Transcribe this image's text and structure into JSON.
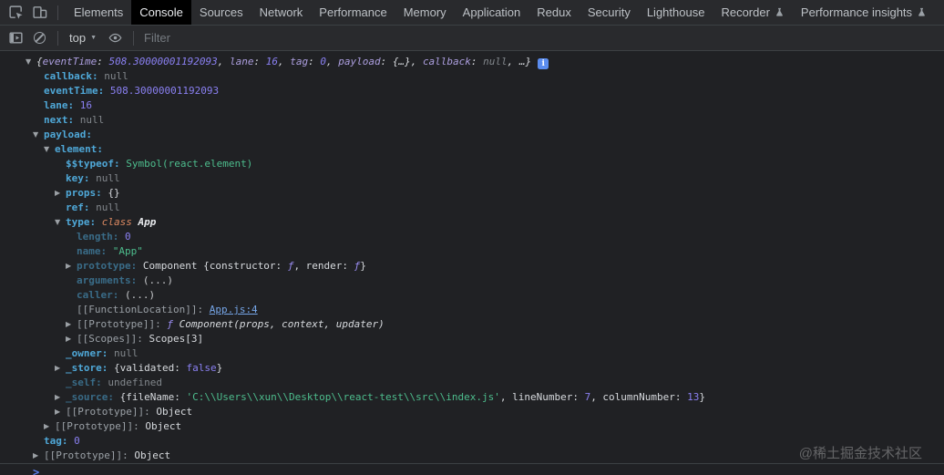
{
  "devtools": {
    "tabs": [
      {
        "label": "Elements",
        "active": false,
        "flask": false
      },
      {
        "label": "Console",
        "active": true,
        "flask": false
      },
      {
        "label": "Sources",
        "active": false,
        "flask": false
      },
      {
        "label": "Network",
        "active": false,
        "flask": false
      },
      {
        "label": "Performance",
        "active": false,
        "flask": false
      },
      {
        "label": "Memory",
        "active": false,
        "flask": false
      },
      {
        "label": "Application",
        "active": false,
        "flask": false
      },
      {
        "label": "Redux",
        "active": false,
        "flask": false
      },
      {
        "label": "Security",
        "active": false,
        "flask": false
      },
      {
        "label": "Lighthouse",
        "active": false,
        "flask": false
      },
      {
        "label": "Recorder",
        "active": false,
        "flask": true
      },
      {
        "label": "Performance insights",
        "active": false,
        "flask": true
      }
    ]
  },
  "toolbar": {
    "context": "top",
    "filter_placeholder": "Filter"
  },
  "colors": {
    "background": "#202124",
    "toolbar": "#292a2d",
    "active_tab": "#000000",
    "property_key": "#4fa8d8",
    "number": "#8a80f2",
    "string": "#4dbd8d",
    "null_undefined": "#82878c",
    "preview_key": "#ad9fe0",
    "keyword": "#de8a62",
    "link": "#76a6e8",
    "info_badge": "#5b8def"
  },
  "console": {
    "rows": [
      {
        "indent": 0,
        "arrow": "v",
        "key": "",
        "kc": "",
        "italic": true,
        "info": true,
        "segs": [
          [
            "{",
            "obj"
          ],
          [
            "eventTime",
            "pkey"
          ],
          [
            ": ",
            "obj"
          ],
          [
            "508.30000001192093",
            "num"
          ],
          [
            ", ",
            "obj"
          ],
          [
            "lane",
            "pkey"
          ],
          [
            ": ",
            "obj"
          ],
          [
            "16",
            "num"
          ],
          [
            ", ",
            "obj"
          ],
          [
            "tag",
            "pkey"
          ],
          [
            ": ",
            "obj"
          ],
          [
            "0",
            "num"
          ],
          [
            ", ",
            "obj"
          ],
          [
            "payload",
            "pkey"
          ],
          [
            ": ",
            "obj"
          ],
          [
            "{…}",
            "obj"
          ],
          [
            ", ",
            "obj"
          ],
          [
            "callback",
            "pkey"
          ],
          [
            ": ",
            "obj"
          ],
          [
            "null",
            "null"
          ],
          [
            ", ",
            "obj"
          ],
          [
            "…}",
            "obj"
          ]
        ]
      },
      {
        "indent": 1,
        "arrow": "",
        "key": "callback:",
        "kc": "k-key",
        "segs": [
          [
            "null",
            "null"
          ]
        ]
      },
      {
        "indent": 1,
        "arrow": "",
        "key": "eventTime:",
        "kc": "k-key",
        "segs": [
          [
            "508.30000001192093",
            "num"
          ]
        ]
      },
      {
        "indent": 1,
        "arrow": "",
        "key": "lane:",
        "kc": "k-key",
        "segs": [
          [
            "16",
            "num"
          ]
        ]
      },
      {
        "indent": 1,
        "arrow": "",
        "key": "next:",
        "kc": "k-key",
        "segs": [
          [
            "null",
            "null"
          ]
        ]
      },
      {
        "indent": 1,
        "arrow": "v",
        "key": "payload:",
        "kc": "k-key",
        "segs": []
      },
      {
        "indent": 2,
        "arrow": "v",
        "key": "element:",
        "kc": "k-key",
        "segs": []
      },
      {
        "indent": 3,
        "arrow": "",
        "key": "$$typeof:",
        "kc": "k-key",
        "segs": [
          [
            "Symbol(react.element)",
            "str"
          ]
        ]
      },
      {
        "indent": 3,
        "arrow": "",
        "key": "key:",
        "kc": "k-key",
        "segs": [
          [
            "null",
            "null"
          ]
        ]
      },
      {
        "indent": 3,
        "arrow": "r",
        "key": "props:",
        "kc": "k-key",
        "segs": [
          [
            "{}",
            "white"
          ]
        ]
      },
      {
        "indent": 3,
        "arrow": "",
        "key": "ref:",
        "kc": "k-key",
        "segs": [
          [
            "null",
            "null"
          ]
        ]
      },
      {
        "indent": 3,
        "arrow": "v",
        "key": "type:",
        "kc": "k-key",
        "segs": [
          [
            "class",
            "kw"
          ],
          [
            " ",
            "white"
          ],
          [
            "App",
            "clsname"
          ]
        ]
      },
      {
        "indent": 4,
        "arrow": "",
        "key": "length:",
        "kc": "k-keydim",
        "segs": [
          [
            "0",
            "num"
          ]
        ]
      },
      {
        "indent": 4,
        "arrow": "",
        "key": "name:",
        "kc": "k-keydim",
        "segs": [
          [
            "\"App\"",
            "str"
          ]
        ]
      },
      {
        "indent": 4,
        "arrow": "r",
        "key": "prototype:",
        "kc": "k-keydim",
        "segs": [
          [
            "Component {constructor: ",
            "white"
          ],
          [
            "ƒ",
            "fsym"
          ],
          [
            ", render: ",
            "white"
          ],
          [
            "ƒ",
            "fsym"
          ],
          [
            "}",
            "white"
          ]
        ]
      },
      {
        "indent": 4,
        "arrow": "",
        "key": "arguments:",
        "kc": "k-keydim",
        "segs": [
          [
            "(...)",
            "paren"
          ]
        ]
      },
      {
        "indent": 4,
        "arrow": "",
        "key": "caller:",
        "kc": "k-keydim",
        "segs": [
          [
            "(...)",
            "paren"
          ]
        ]
      },
      {
        "indent": 4,
        "arrow": "",
        "key": "[[FunctionLocation]]:",
        "kc": "k-internal",
        "segs": [
          [
            "App.js:4",
            "link"
          ]
        ]
      },
      {
        "indent": 4,
        "arrow": "r",
        "key": "[[Prototype]]:",
        "kc": "k-internal",
        "segs": [
          [
            "ƒ",
            "fsym"
          ],
          [
            " Component(props, context, updater)",
            "fn"
          ]
        ]
      },
      {
        "indent": 4,
        "arrow": "r",
        "key": "[[Scopes]]:",
        "kc": "k-internal",
        "segs": [
          [
            "Scopes[3]",
            "white"
          ]
        ]
      },
      {
        "indent": 3,
        "arrow": "",
        "key": "_owner:",
        "kc": "k-key",
        "segs": [
          [
            "null",
            "null"
          ]
        ]
      },
      {
        "indent": 3,
        "arrow": "r",
        "key": "_store:",
        "kc": "k-key",
        "segs": [
          [
            "{validated: ",
            "white"
          ],
          [
            "false",
            "num"
          ],
          [
            "}",
            "white"
          ]
        ]
      },
      {
        "indent": 3,
        "arrow": "",
        "key": "_self:",
        "kc": "k-keydim",
        "segs": [
          [
            "undefined",
            "null"
          ]
        ]
      },
      {
        "indent": 3,
        "arrow": "r",
        "key": "_source:",
        "kc": "k-keydim",
        "segs": [
          [
            "{fileName: ",
            "white"
          ],
          [
            "'C:\\\\Users\\\\xun\\\\Desktop\\\\react-test\\\\src\\\\index.js'",
            "str"
          ],
          [
            ", lineNumber: ",
            "white"
          ],
          [
            "7",
            "num"
          ],
          [
            ", columnNumber: ",
            "white"
          ],
          [
            "13",
            "num"
          ],
          [
            "}",
            "white"
          ]
        ]
      },
      {
        "indent": 3,
        "arrow": "r",
        "key": "[[Prototype]]:",
        "kc": "k-internal",
        "segs": [
          [
            "Object",
            "white"
          ]
        ]
      },
      {
        "indent": 2,
        "arrow": "r",
        "key": "[[Prototype]]:",
        "kc": "k-internal",
        "segs": [
          [
            "Object",
            "white"
          ]
        ]
      },
      {
        "indent": 1,
        "arrow": "",
        "key": "tag:",
        "kc": "k-key",
        "segs": [
          [
            "0",
            "num"
          ]
        ]
      },
      {
        "indent": 1,
        "arrow": "r",
        "key": "[[Prototype]]:",
        "kc": "k-internal",
        "segs": [
          [
            "Object",
            "white"
          ]
        ]
      }
    ]
  },
  "prompt": {
    "chevron": ">"
  },
  "watermark": "@稀土掘金技术社区"
}
